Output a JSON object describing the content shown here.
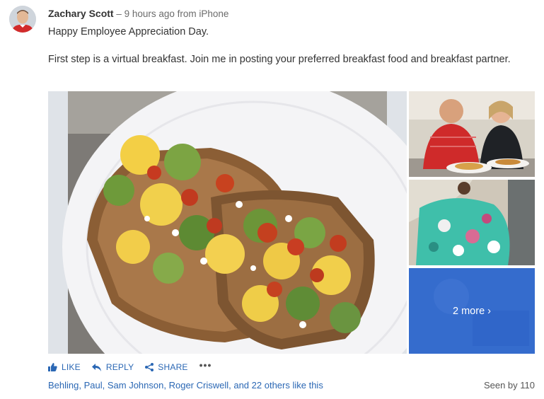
{
  "post": {
    "author": "Zachary Scott",
    "meta": " – 9 hours ago from iPhone",
    "message_line1": "Happy Employee Appreciation Day.",
    "message_line2": "First step is a virtual breakfast. Join me in posting your preferred breakfast food and breakfast partner."
  },
  "gallery": {
    "more_label": "2 more ›",
    "main_image": "avocado-egg-toast-photo",
    "thumbnails": [
      "couple-breakfast-photo",
      "dog-under-blanket-photo"
    ]
  },
  "actions": {
    "like": "LIKE",
    "reply": "REPLY",
    "share": "SHARE",
    "more": "•••"
  },
  "likes": {
    "names": [
      "Behling, Paul",
      "Sam Johnson",
      "Roger Criswell"
    ],
    "sep1": ", ",
    "sep2": ", ",
    "and": ", and ",
    "others": "22 others",
    "suffix": " like this"
  },
  "seen": "Seen by 110",
  "colors": {
    "link": "#2a67b4",
    "overlay": "#2864d2"
  }
}
